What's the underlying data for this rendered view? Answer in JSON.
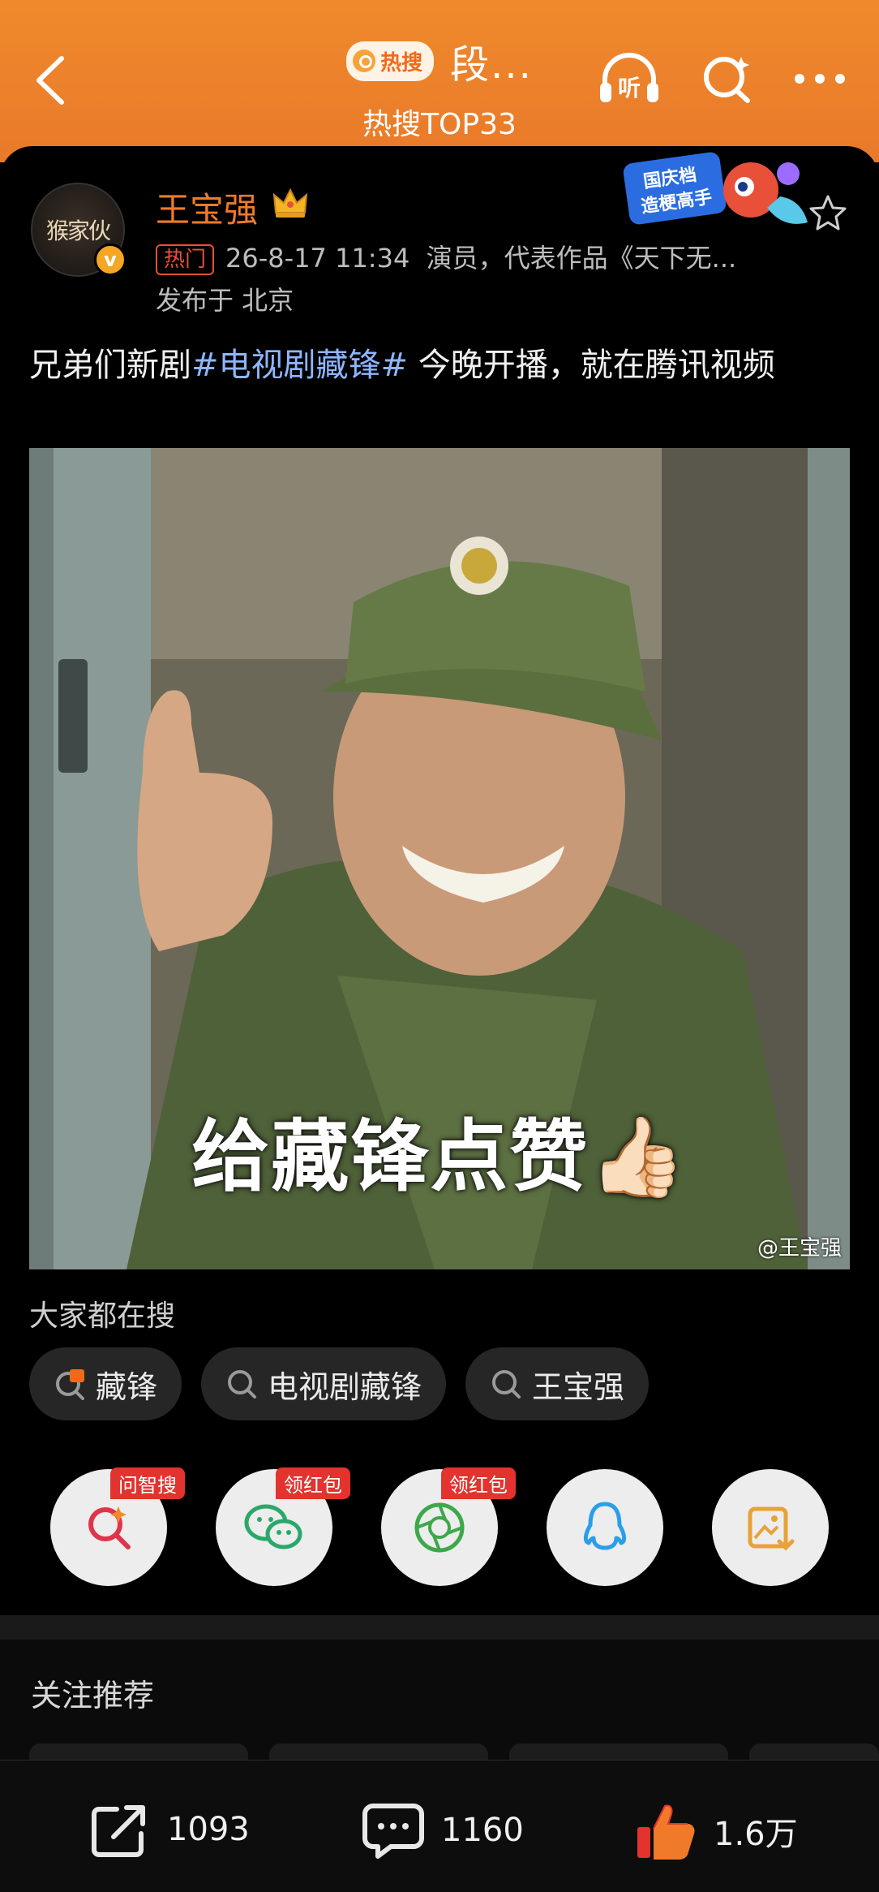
{
  "header": {
    "badge": "热搜",
    "topic": "段...",
    "rank": "热搜TOP33"
  },
  "post": {
    "username": "王宝强",
    "avatar_text": "猴家伙",
    "verified_mark": "v",
    "hot_tag": "热门",
    "time": "26-8-17 11:34",
    "desc": "演员，代表作品《天下无...",
    "location": "发布于 北京",
    "text_before": "兄弟们新剧",
    "hashtag": "#电视剧藏锋#",
    "text_after": " 今晚开播，就在腾讯视频",
    "image_caption": "给藏锋点赞👍🏻",
    "watermark": "@王宝强"
  },
  "sticker": {
    "line1": "国庆档",
    "line2": "造梗高手"
  },
  "search": {
    "label": "大家都在搜",
    "chips": [
      {
        "text": "藏锋",
        "icon": "hot-search-icon"
      },
      {
        "text": "电视剧藏锋",
        "icon": "search-icon"
      },
      {
        "text": "王宝强",
        "icon": "search-icon"
      }
    ]
  },
  "share": {
    "buttons": [
      {
        "name": "ai-search",
        "ribbon": "问智搜"
      },
      {
        "name": "wechat",
        "ribbon": "领红包"
      },
      {
        "name": "moments",
        "ribbon": "领红包"
      },
      {
        "name": "qq",
        "ribbon": ""
      },
      {
        "name": "save-image",
        "ribbon": ""
      }
    ]
  },
  "follow": {
    "label": "关注推荐"
  },
  "bottom": {
    "repost": "1093",
    "comment": "1160",
    "like": "1.6万"
  },
  "colors": {
    "header": "#ef8a2c",
    "username": "#f07a2a",
    "hashtag": "#8eb6ff",
    "hot": "#e8503a"
  }
}
